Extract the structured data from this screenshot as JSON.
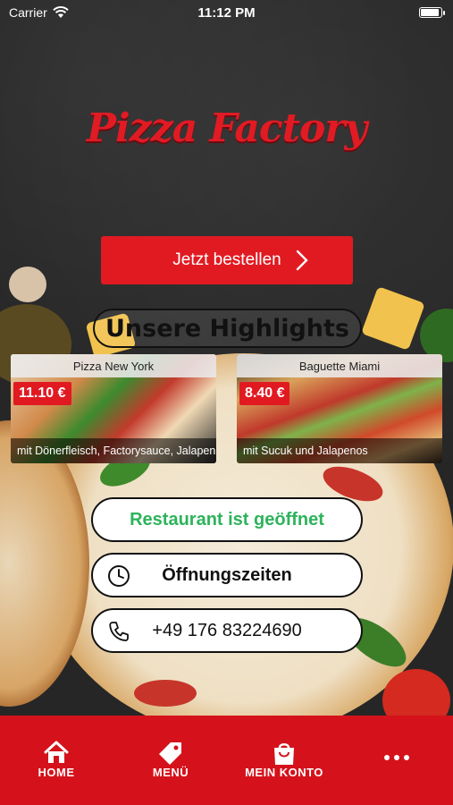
{
  "status_bar": {
    "carrier": "Carrier",
    "time": "11:12 PM"
  },
  "brand": {
    "logo_text": "Pizza Factory",
    "accent_color": "#e11a22"
  },
  "order_button": {
    "label": "Jetzt bestellen"
  },
  "highlights": {
    "title": "Unsere Highlights",
    "items": [
      {
        "name": "Pizza New York",
        "price": "11.10 €",
        "description": "mit Dönerfleisch, Factorysauce, Jalapen..."
      },
      {
        "name": "Baguette Miami",
        "price": "8.40 €",
        "description": "mit Sucuk und Jalapenos"
      }
    ]
  },
  "info": {
    "open_status": "Restaurant ist geöffnet",
    "open_color": "#2db35b",
    "hours_label": "Öffnungszeiten",
    "phone": "+49 176 83224690"
  },
  "tabbar": {
    "items": [
      {
        "label": "HOME",
        "icon": "home-icon"
      },
      {
        "label": "MENÜ",
        "icon": "tag-icon"
      },
      {
        "label": "MEIN KONTO",
        "icon": "shopping-bag-icon"
      },
      {
        "label": "",
        "icon": "more-dots-icon"
      }
    ]
  }
}
